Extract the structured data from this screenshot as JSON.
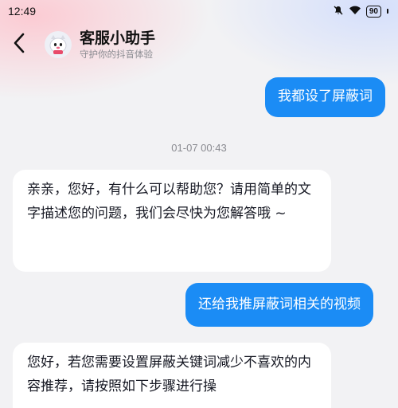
{
  "status_bar": {
    "time": "12:49",
    "battery": "90",
    "icons": [
      "mute-icon",
      "wifi-icon",
      "battery-icon"
    ]
  },
  "header": {
    "back_icon": "chevron-left-icon",
    "avatar_icon": "assistant-avatar",
    "title": "客服小助手",
    "subtitle": "守护你的抖音体验"
  },
  "messages": [
    {
      "side": "out",
      "text": "我都设了屏蔽词"
    },
    {
      "side": "in",
      "text": "亲亲，您好，有什么可以帮助您？请用简单的文字描述您的问题，我们会尽快为您解答哦 ~"
    },
    {
      "side": "out",
      "text": "还给我推屏蔽词相关的视频"
    },
    {
      "side": "in",
      "text": "您好，若您需要设置屏蔽关键词减少不喜欢的内容推荐，请按照如下步骤进行操"
    }
  ],
  "timestamp": "01-07 00:43",
  "colors": {
    "outgoing_bubble": "#1b8cf5",
    "incoming_bubble": "#ffffff",
    "background": "#f2f2f4"
  }
}
